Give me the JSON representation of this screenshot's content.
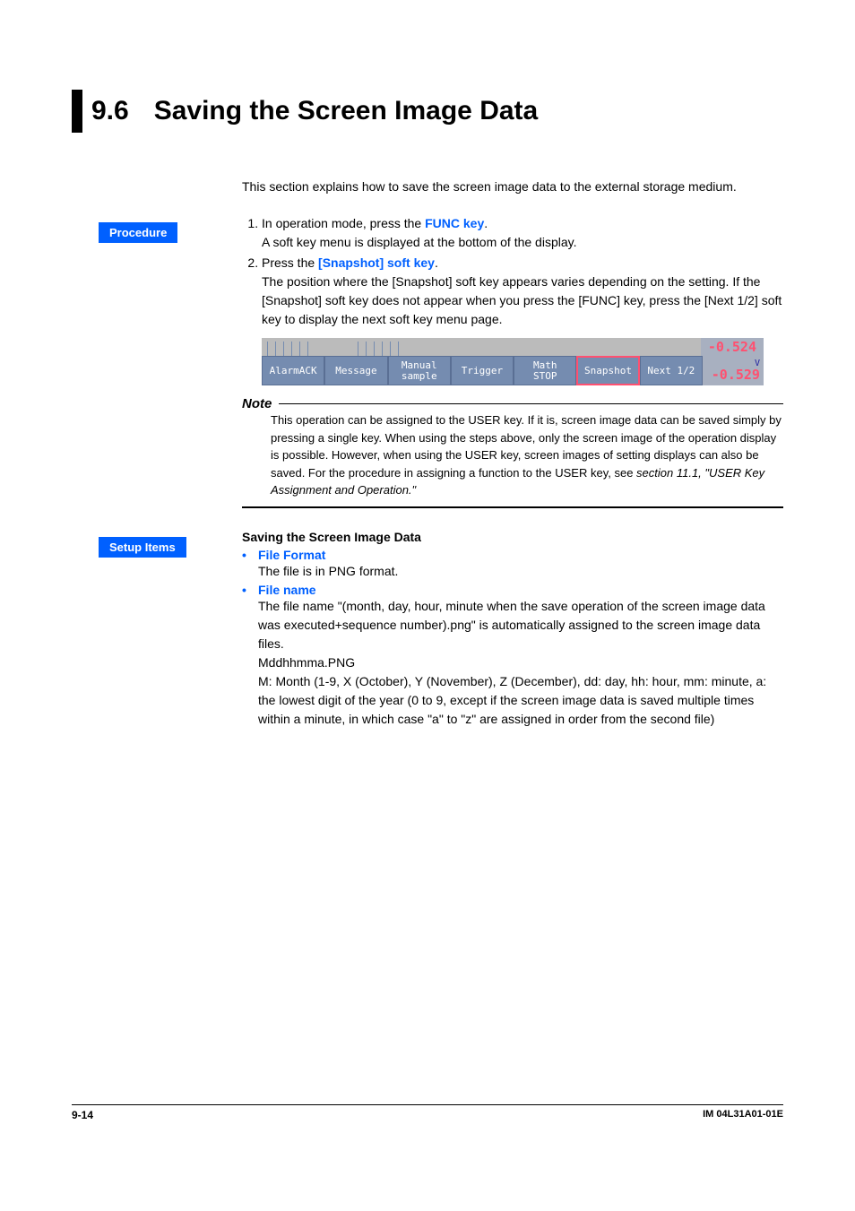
{
  "section": {
    "number": "9.6",
    "title": "Saving the Screen Image Data"
  },
  "intro": "This section explains how to save the screen image data to the external storage medium.",
  "labels": {
    "procedure": "Procedure",
    "setup_items": "Setup Items"
  },
  "steps": {
    "s1a": "In operation mode, press the ",
    "s1_key": "FUNC key",
    "s1_post": ".",
    "s1b": "A soft key menu is displayed at the bottom of the display.",
    "s2a": "Press the ",
    "s2_key": "[Snapshot] soft key",
    "s2_post": ".",
    "s2b": "The position where the [Snapshot] soft key appears varies depending on the setting. If the [Snapshot] soft key does not appear when you press the [FUNC] key, press the [Next 1/2] soft key to display the next soft key menu page."
  },
  "screenshot": {
    "topval": "-0.524",
    "unit": "V",
    "botval": "-0.529",
    "keys": {
      "k1": "AlarmACK",
      "k2": "Message",
      "k3a": "Manual",
      "k3b": "sample",
      "k4": "Trigger",
      "k5a": "Math",
      "k5b": "STOP",
      "k6": "Snapshot",
      "k7": "Next 1/2"
    }
  },
  "note": {
    "label": "Note",
    "body": "This operation can be assigned to the USER key.  If it is, screen image data can be saved simply by pressing a single key.  When using the steps above, only the screen image of the operation display is possible.  However, when using the USER key, screen images of setting displays can also be saved.  For the procedure in assigning a function to the USER key, see ",
    "ref": "section 11.1, \"USER Key Assignment and Operation.\""
  },
  "setup": {
    "title": "Saving the Screen Image Data",
    "b1": {
      "label": "File Format",
      "body": "The file is in PNG format."
    },
    "b2": {
      "label": "File name",
      "body1": "The file name \"(month, day, hour, minute when the save operation of the screen image data was executed+sequence number).png\" is automatically assigned to the screen image data files.",
      "body2": "Mddhhmma.PNG",
      "body3": "M: Month (1-9, X (October), Y (November), Z (December), dd: day, hh: hour, mm: minute, a: the lowest digit of the year (0 to 9, except if the screen image data is saved multiple times within a minute, in which case \"a\" to \"z\" are assigned in order from the second file)"
    }
  },
  "footer": {
    "page": "9-14",
    "doc": "IM 04L31A01-01E"
  }
}
